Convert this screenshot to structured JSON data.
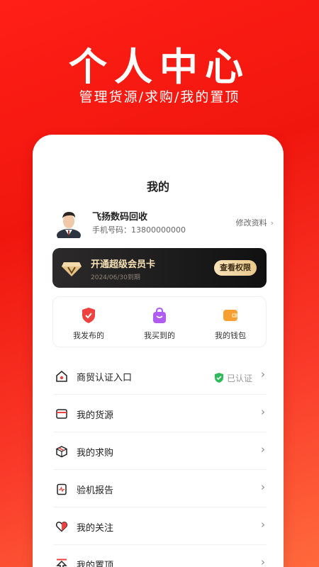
{
  "hero": {
    "title": "个人中心",
    "subtitle": "管理货源/求购/我的置顶"
  },
  "page_title": "我的",
  "profile": {
    "name": "飞扬数码回收",
    "phone": "手机号码：13800000000",
    "edit_label": "修改资料"
  },
  "vip": {
    "title": "开通超级会员卡",
    "expiry": "2024/06/30到期",
    "button_label": "查看权限"
  },
  "quick_actions": [
    {
      "label": "我发布的",
      "icon": "shield-icon",
      "color": "#f04141"
    },
    {
      "label": "我买到的",
      "icon": "shopping-bag-icon",
      "color": "#b05cf0"
    },
    {
      "label": "我的钱包",
      "icon": "wallet-icon",
      "color": "#f5a030"
    }
  ],
  "menu": [
    {
      "label": "商贸认证入口",
      "icon": "house-icon",
      "status": "已认证"
    },
    {
      "label": "我的货源",
      "icon": "card-icon"
    },
    {
      "label": "我的求购",
      "icon": "box-icon"
    },
    {
      "label": "验机报告",
      "icon": "report-icon"
    },
    {
      "label": "我的关注",
      "icon": "heart-icon"
    },
    {
      "label": "我的置顶",
      "icon": "pin-icon"
    }
  ],
  "colors": {
    "brand_red": "#f0160e",
    "verified_green": "#2dbb5a"
  }
}
